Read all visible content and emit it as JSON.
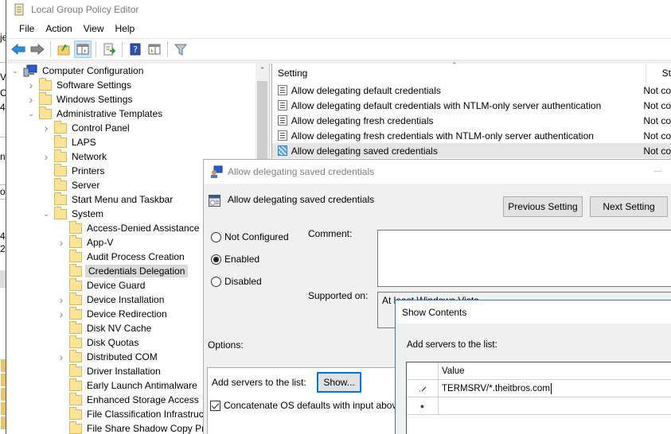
{
  "window": {
    "title": "Local Group Policy Editor"
  },
  "background_window": {
    "fragments": [
      "je",
      "V",
      "C",
      "4",
      "n",
      "o",
      "4",
      "2"
    ]
  },
  "menu": {
    "items": [
      "File",
      "Action",
      "View",
      "Help"
    ]
  },
  "toolbar": {
    "buttons": [
      "back-icon",
      "forward-icon",
      "up-folder-icon",
      "show-hide-console-tree-icon",
      "export-list-icon",
      "help-icon",
      "show-hide-action-pane-icon",
      "filter-icon"
    ],
    "active": "show-hide-console-tree-icon"
  },
  "tree": {
    "root": "Computer Configuration",
    "items": [
      {
        "label": "Software Settings",
        "level": 1,
        "expander": "collapsed"
      },
      {
        "label": "Windows Settings",
        "level": 1,
        "expander": "collapsed"
      },
      {
        "label": "Administrative Templates",
        "level": 1,
        "expander": "expanded"
      },
      {
        "label": "Control Panel",
        "level": 2,
        "expander": "collapsed"
      },
      {
        "label": "LAPS",
        "level": 2,
        "expander": "none"
      },
      {
        "label": "Network",
        "level": 2,
        "expander": "collapsed"
      },
      {
        "label": "Printers",
        "level": 2,
        "expander": "none"
      },
      {
        "label": "Server",
        "level": 2,
        "expander": "none"
      },
      {
        "label": "Start Menu and Taskbar",
        "level": 2,
        "expander": "none"
      },
      {
        "label": "System",
        "level": 2,
        "expander": "expanded"
      },
      {
        "label": "Access-Denied Assistance",
        "level": 3,
        "expander": "none"
      },
      {
        "label": "App-V",
        "level": 3,
        "expander": "collapsed"
      },
      {
        "label": "Audit Process Creation",
        "level": 3,
        "expander": "none"
      },
      {
        "label": "Credentials Delegation",
        "level": 3,
        "expander": "none",
        "selected": true
      },
      {
        "label": "Device Guard",
        "level": 3,
        "expander": "none"
      },
      {
        "label": "Device Installation",
        "level": 3,
        "expander": "collapsed"
      },
      {
        "label": "Device Redirection",
        "level": 3,
        "expander": "collapsed"
      },
      {
        "label": "Disk NV Cache",
        "level": 3,
        "expander": "none"
      },
      {
        "label": "Disk Quotas",
        "level": 3,
        "expander": "none"
      },
      {
        "label": "Distributed COM",
        "level": 3,
        "expander": "collapsed"
      },
      {
        "label": "Driver Installation",
        "level": 3,
        "expander": "none"
      },
      {
        "label": "Early Launch Antimalware",
        "level": 3,
        "expander": "none"
      },
      {
        "label": "Enhanced Storage Access",
        "level": 3,
        "expander": "none"
      },
      {
        "label": "File Classification Infrastructure",
        "level": 3,
        "expander": "none"
      },
      {
        "label": "File Share Shadow Copy Provider",
        "level": 3,
        "expander": "none"
      }
    ]
  },
  "settings_list": {
    "columns": [
      "Setting",
      "State"
    ],
    "column_visible": [
      "Setting",
      "St"
    ],
    "rows": [
      {
        "name": "Allow delegating default credentials",
        "state": "Not configured",
        "state_visible": "Not co"
      },
      {
        "name": "Allow delegating default credentials with NTLM-only server authentication",
        "state": "Not configured",
        "state_visible": "Not co"
      },
      {
        "name": "Allow delegating fresh credentials",
        "state": "Not configured",
        "state_visible": "Not co"
      },
      {
        "name": "Allow delegating fresh credentials with NTLM-only server authentication",
        "state": "Not configured",
        "state_visible": "Not co"
      },
      {
        "name": "Allow delegating saved credentials",
        "state": "Not configured",
        "state_visible": "Not co",
        "selected": true
      }
    ]
  },
  "policy_dialog": {
    "title": "Allow delegating saved credentials",
    "heading": "Allow delegating saved credentials",
    "previous_label": "Previous Setting",
    "next_label": "Next Setting",
    "radios": [
      {
        "label": "Not Configured",
        "checked": false
      },
      {
        "label": "Enabled",
        "checked": true
      },
      {
        "label": "Disabled",
        "checked": false
      }
    ],
    "comment_label": "Comment:",
    "comment_value": "",
    "supported_label": "Supported on:",
    "supported_value": "At least Windows Vista",
    "options_label": "Options:",
    "add_servers_label": "Add servers to the list:",
    "show_label": "Show...",
    "concatenate_label": "Concatenate OS defaults with input above",
    "concatenate_checked": true
  },
  "show_contents": {
    "title": "Show Contents",
    "label": "Add servers to the list:",
    "column": "Value",
    "rows": [
      {
        "marker": "edit-pencil-icon",
        "value": "TERMSRV/*.theitbros.com"
      },
      {
        "marker": "new-row-icon",
        "value": ""
      }
    ]
  }
}
